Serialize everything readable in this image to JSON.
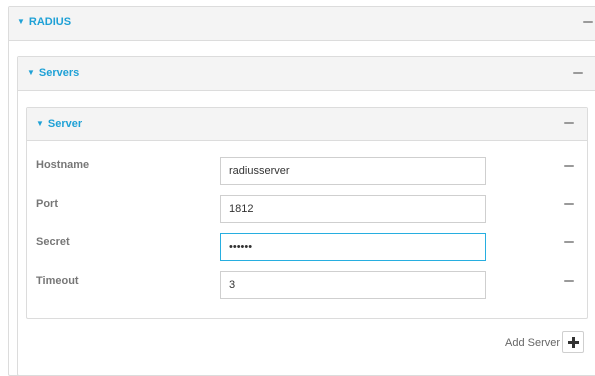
{
  "radius": {
    "title": "RADIUS"
  },
  "servers": {
    "title": "Servers"
  },
  "server": {
    "title": "Server",
    "fields": [
      {
        "label": "Hostname",
        "value": "radiusserver"
      },
      {
        "label": "Port",
        "value": "1812"
      },
      {
        "label": "Secret",
        "value": "••••••",
        "focused": true
      },
      {
        "label": "Timeout",
        "value": "3"
      }
    ]
  },
  "add_server": {
    "label": "Add Server",
    "icon": "plus-icon"
  },
  "icons": {
    "caret": "caret-down-icon",
    "menu": "menu-icon"
  },
  "colors": {
    "accent": "#1fa1d6",
    "header_bg": "#f4f4f4",
    "border": "#dcdcdc",
    "focus": "#27aee0"
  }
}
